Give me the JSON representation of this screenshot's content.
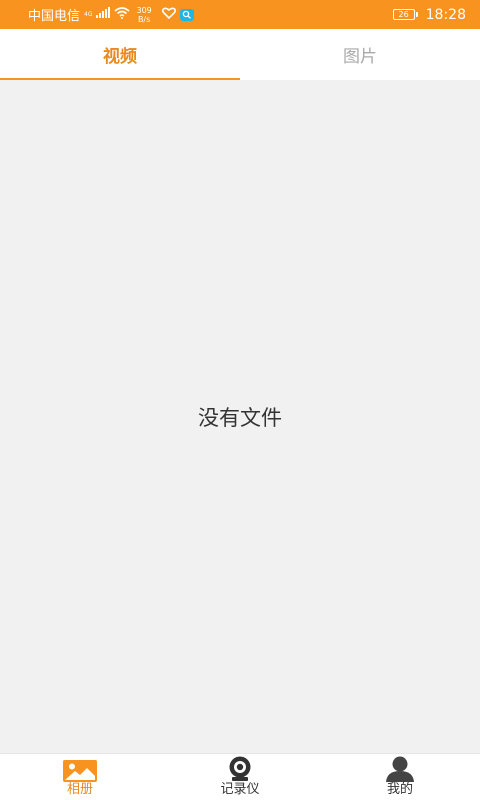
{
  "status_bar": {
    "carrier": "中国电信",
    "network": "4G",
    "speed_value": "309",
    "speed_unit": "B/s",
    "battery": "26",
    "time": "18:28"
  },
  "tabs": [
    {
      "label": "视频",
      "active": true
    },
    {
      "label": "图片",
      "active": false
    }
  ],
  "content": {
    "empty_message": "没有文件"
  },
  "bottom_nav": [
    {
      "label": "相册",
      "icon": "photo-album-icon",
      "active": true
    },
    {
      "label": "记录仪",
      "icon": "camera-recorder-icon",
      "active": false
    },
    {
      "label": "我的",
      "icon": "user-profile-icon",
      "active": false
    }
  ],
  "colors": {
    "accent": "#f7931e",
    "accent_text": "#e88a22",
    "background": "#f1f1f1",
    "inactive_tab": "#a9a9a9",
    "icon_dark": "#333333"
  }
}
